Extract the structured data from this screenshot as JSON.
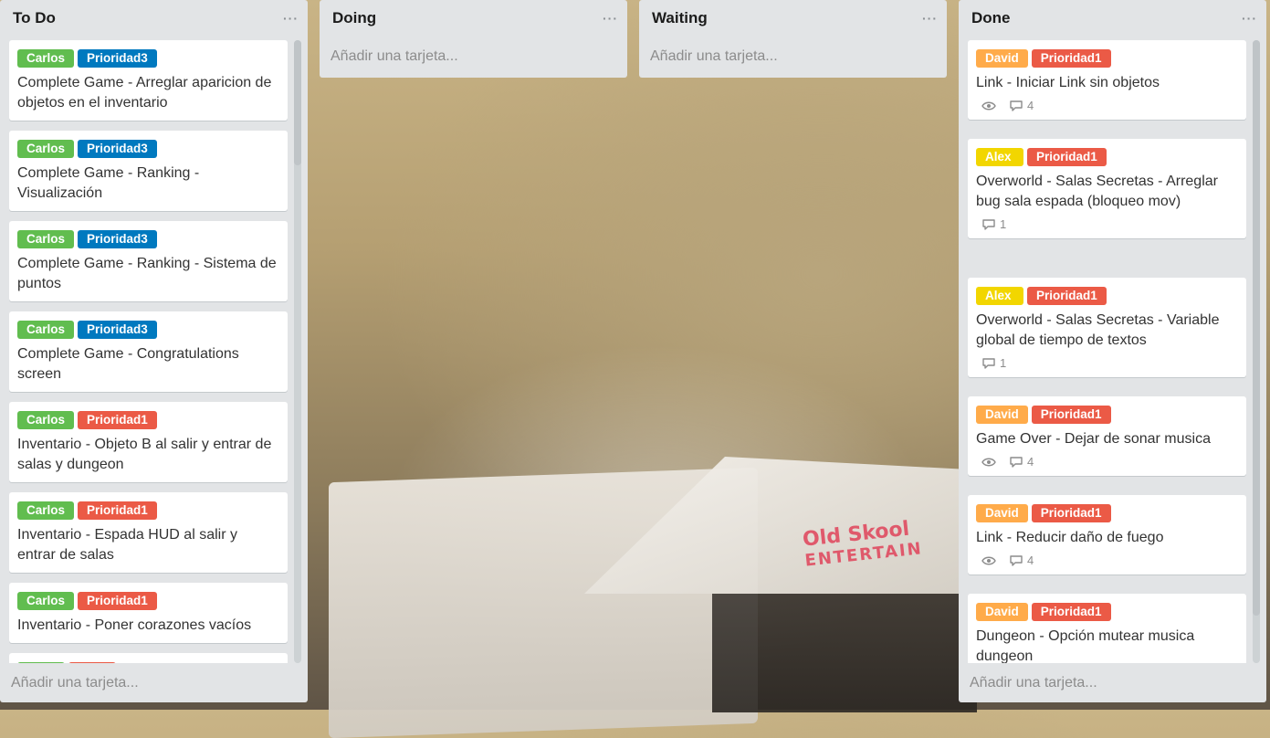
{
  "labels": {
    "green": "#61bd4f",
    "blue": "#0079bf",
    "red": "#eb5a46",
    "orange": "#ffab4a",
    "yellow": "#f2d600"
  },
  "background": {
    "text1": "Old Skool",
    "text2": "ENTERTAIN"
  },
  "lists": [
    {
      "title": "To Do",
      "add_card": "Añadir una tarjeta...",
      "cards": [
        {
          "labels": [
            {
              "text": "Carlos",
              "color": "#61bd4f"
            },
            {
              "text": "Prioridad3",
              "color": "#0079bf"
            }
          ],
          "title": "Complete Game - Arreglar aparicion de objetos en el inventario"
        },
        {
          "labels": [
            {
              "text": "Carlos",
              "color": "#61bd4f"
            },
            {
              "text": "Prioridad3",
              "color": "#0079bf"
            }
          ],
          "title": "Complete Game - Ranking - Visualización"
        },
        {
          "labels": [
            {
              "text": "Carlos",
              "color": "#61bd4f"
            },
            {
              "text": "Prioridad3",
              "color": "#0079bf"
            }
          ],
          "title": "Complete Game - Ranking - Sistema de puntos"
        },
        {
          "labels": [
            {
              "text": "Carlos",
              "color": "#61bd4f"
            },
            {
              "text": "Prioridad3",
              "color": "#0079bf"
            }
          ],
          "title": "Complete Game - Congratulations screen"
        },
        {
          "labels": [
            {
              "text": "Carlos",
              "color": "#61bd4f"
            },
            {
              "text": "Prioridad1",
              "color": "#eb5a46"
            }
          ],
          "title": "Inventario - Objeto B al salir y entrar de salas y dungeon"
        },
        {
          "labels": [
            {
              "text": "Carlos",
              "color": "#61bd4f"
            },
            {
              "text": "Prioridad1",
              "color": "#eb5a46"
            }
          ],
          "title": "Inventario - Espada HUD al salir y entrar de salas"
        },
        {
          "labels": [
            {
              "text": "Carlos",
              "color": "#61bd4f"
            },
            {
              "text": "Prioridad1",
              "color": "#eb5a46"
            }
          ],
          "title": "Inventario - Poner corazones vacíos"
        },
        {
          "labels": [
            {
              "text": "",
              "color": "#61bd4f"
            },
            {
              "text": "",
              "color": "#eb5a46"
            }
          ],
          "title": ""
        }
      ]
    },
    {
      "title": "Doing",
      "add_card": "Añadir una tarjeta..."
    },
    {
      "title": "Waiting",
      "add_card": "Añadir una tarjeta..."
    },
    {
      "title": "Done",
      "add_card": "Añadir una tarjeta...",
      "cards": [
        {
          "labels": [
            {
              "text": "David",
              "color": "#ffab4a"
            },
            {
              "text": "Prioridad1",
              "color": "#eb5a46"
            }
          ],
          "title": "Link - Iniciar Link sin objetos",
          "watch": true,
          "comments": "4"
        },
        {
          "labels": [
            {
              "text": "Alex",
              "color": "#f2d600"
            },
            {
              "text": "Prioridad1",
              "color": "#eb5a46"
            }
          ],
          "title": "Overworld - Salas Secretas - Arreglar bug sala espada (bloqueo mov)",
          "watch": false,
          "comments": "1"
        },
        {
          "labels": [
            {
              "text": "Alex",
              "color": "#f2d600"
            },
            {
              "text": "Prioridad1",
              "color": "#eb5a46"
            }
          ],
          "title": "Overworld - Salas Secretas - Variable global de tiempo de textos",
          "watch": false,
          "comments": "1"
        },
        {
          "labels": [
            {
              "text": "David",
              "color": "#ffab4a"
            },
            {
              "text": "Prioridad1",
              "color": "#eb5a46"
            }
          ],
          "title": "Game Over - Dejar de sonar musica",
          "watch": true,
          "comments": "4"
        },
        {
          "labels": [
            {
              "text": "David",
              "color": "#ffab4a"
            },
            {
              "text": "Prioridad1",
              "color": "#eb5a46"
            }
          ],
          "title": "Link - Reducir daño de fuego",
          "watch": true,
          "comments": "4"
        },
        {
          "labels": [
            {
              "text": "David",
              "color": "#ffab4a"
            },
            {
              "text": "Prioridad1",
              "color": "#eb5a46"
            }
          ],
          "title": "Dungeon - Opción mutear musica dungeon"
        }
      ]
    }
  ]
}
